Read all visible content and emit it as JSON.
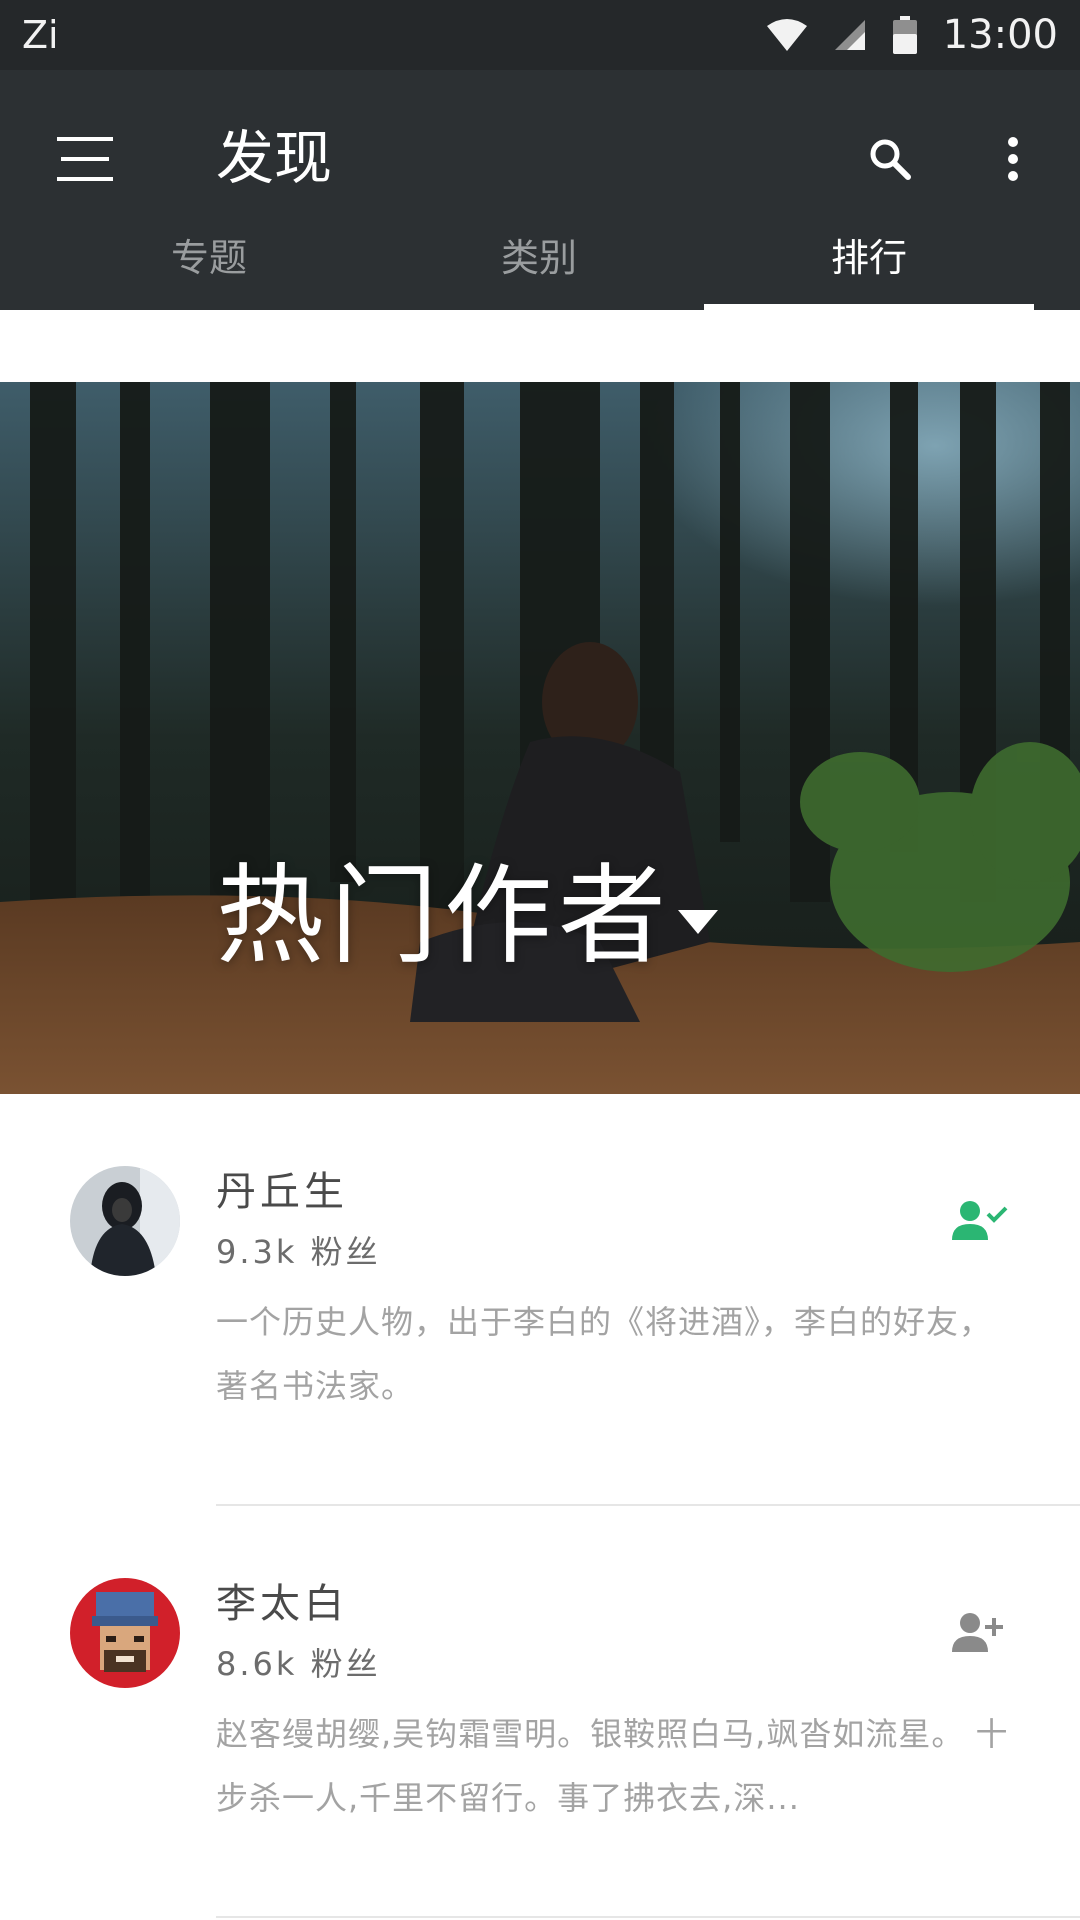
{
  "status_bar": {
    "left_text": "Zi",
    "time": "13:00",
    "icons": [
      "wifi-icon",
      "cell-signal-icon",
      "battery-icon"
    ]
  },
  "app_bar": {
    "title": "发现",
    "icons": [
      "menu-icon",
      "search-icon",
      "more-vert-icon"
    ]
  },
  "tabs": [
    {
      "label": "专题",
      "active": false
    },
    {
      "label": "类别",
      "active": false
    },
    {
      "label": "排行",
      "active": true
    }
  ],
  "hero": {
    "title": "热门作者",
    "dropdown_icon": "triangle-down-icon"
  },
  "authors": [
    {
      "name": "丹丘生",
      "followers": "9.3k  粉丝",
      "bio": "一个历史人物，出于李白的《将进酒》，李白的好友，著名书法家。",
      "follow_state": "following",
      "follow_icon": "person-check-icon",
      "follow_color": "#2bb673"
    },
    {
      "name": "李太白",
      "followers": "8.6k  粉丝",
      "bio": "赵客缦胡缨,吴钩霜雪明。银鞍照白马,飒沓如流星。 十步杀一人,千里不留行。事了拂衣去,深...",
      "follow_state": "not_following",
      "follow_icon": "person-add-icon",
      "follow_color": "#8a8a8a"
    }
  ],
  "colors": {
    "status_bar_bg": "#25282a",
    "app_bar_bg": "#2c3033",
    "tab_active": "#ffffff",
    "tab_inactive": "#9a9d9f",
    "accent_green": "#2bb673"
  }
}
